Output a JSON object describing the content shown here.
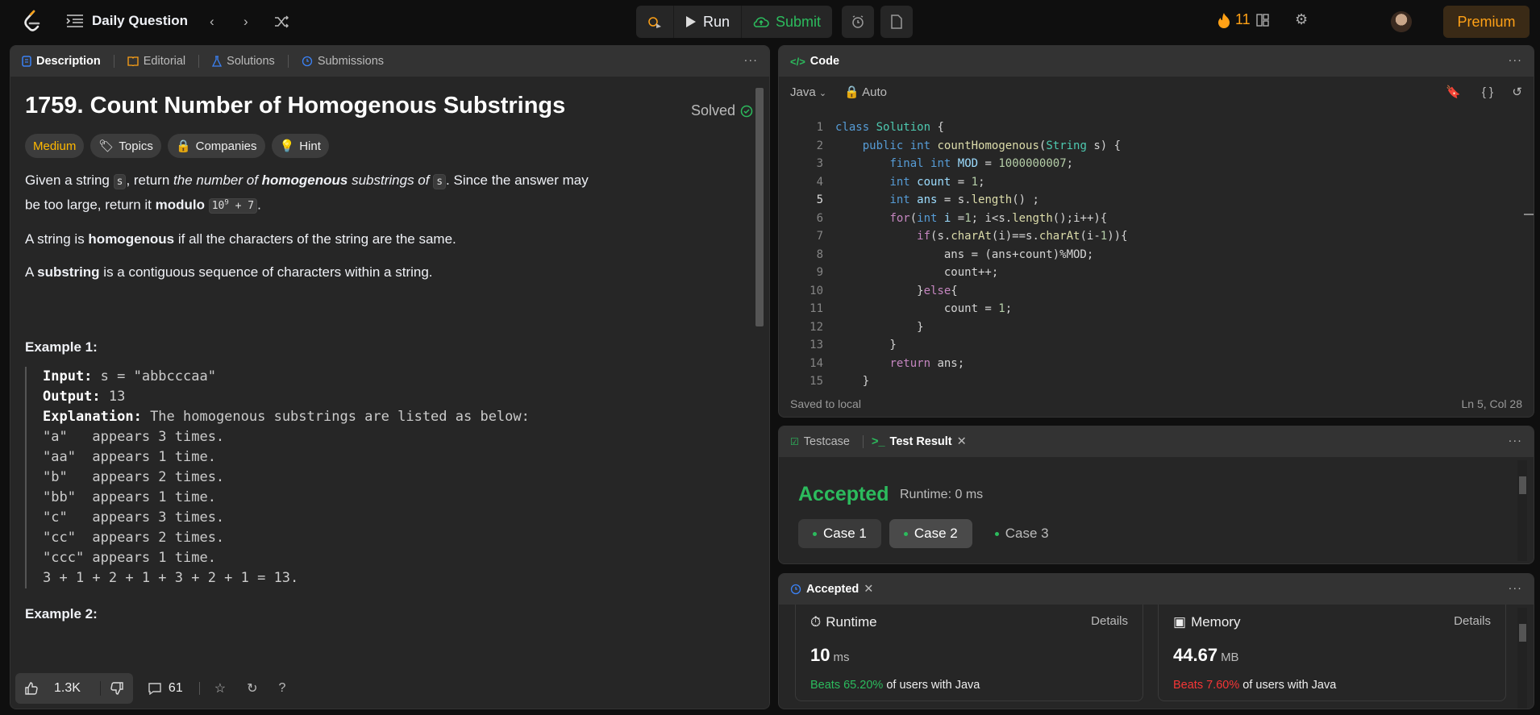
{
  "topbar": {
    "title": "Daily Question",
    "run": "Run",
    "submit": "Submit",
    "streak": "11",
    "premium": "Premium"
  },
  "description": {
    "tabs": [
      "Description",
      "Editorial",
      "Solutions",
      "Submissions"
    ],
    "title": "1759. Count Number of Homogenous Substrings",
    "solved": "Solved",
    "tags": [
      "Medium",
      "Topics",
      "Companies",
      "Hint"
    ],
    "p1": {
      "a": "Given a string ",
      "s1": "s",
      "b": ", return ",
      "c": "the number of ",
      "d": "homogenous",
      "e": " substrings of ",
      "s2": "s",
      "f": ". Since the answer may be too large, return it ",
      "g": "modulo ",
      "mod": "10",
      "exp": "9",
      "plus": " + 7",
      "end": "."
    },
    "p2": {
      "a": "A string is ",
      "b": "homogenous",
      "c": " if all the characters of the string are the same."
    },
    "p3": {
      "a": "A ",
      "b": "substring",
      "c": " is a contiguous sequence of characters within a string."
    },
    "example1": "Example 1:",
    "ex_input_label": "Input:",
    "ex_input": " s = \"abbcccaa\"",
    "ex_output_label": "Output:",
    "ex_output": " 13",
    "ex_expl_label": "Explanation:",
    "ex_expl": " The homogenous substrings are listed as below:",
    "ex_lines": [
      "\"a\"   appears 3 times.",
      "\"aa\"  appears 1 time.",
      "\"b\"   appears 2 times.",
      "\"bb\"  appears 1 time.",
      "\"c\"   appears 3 times.",
      "\"cc\"  appears 2 times.",
      "\"ccc\" appears 1 time.",
      "3 + 1 + 2 + 1 + 3 + 2 + 1 = 13."
    ],
    "example2": "Example 2:",
    "likes": "1.3K",
    "comments": "61"
  },
  "code": {
    "tab": "Code",
    "language": "Java",
    "mode": "Auto",
    "line_numbers": [
      "1",
      "2",
      "3",
      "4",
      "5",
      "6",
      "7",
      "8",
      "9",
      "10",
      "11",
      "12",
      "13",
      "14",
      "15"
    ],
    "saved": "Saved to local",
    "position": "Ln 5, Col 28"
  },
  "testpanel": {
    "tabs": [
      "Testcase",
      "Test Result"
    ],
    "status": "Accepted",
    "runtime": "Runtime: 0 ms",
    "cases": [
      "Case 1",
      "Case 2",
      "Case 3"
    ]
  },
  "result": {
    "tab": "Accepted",
    "runtime_label": "Runtime",
    "runtime_value": "10",
    "runtime_unit": "ms",
    "runtime_beats": "Beats 65.20%",
    "memory_label": "Memory",
    "memory_value": "44.67",
    "memory_unit": "MB",
    "memory_beats": "Beats 7.60%",
    "users_text": " of users with Java",
    "details": "Details"
  }
}
